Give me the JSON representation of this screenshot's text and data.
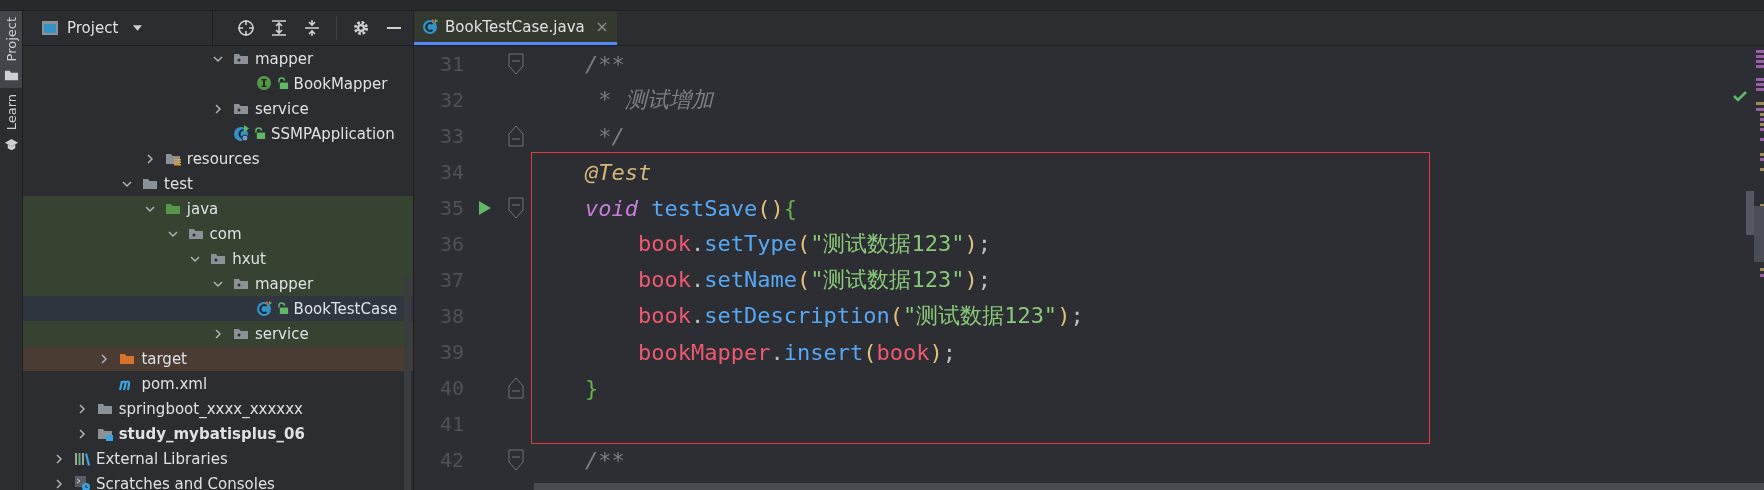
{
  "tool_stripe": [
    {
      "label": "Project",
      "kind": "project",
      "selected": true
    },
    {
      "label": "Learn",
      "kind": "learn",
      "selected": false
    }
  ],
  "project_panel": {
    "title": "Project",
    "tree": [
      {
        "label": "mapper",
        "kind": "package",
        "expanded": true,
        "selected": false,
        "children": [
          {
            "label": "BookMapper",
            "kind": "interface",
            "selected": false
          }
        ]
      },
      {
        "label": "service",
        "kind": "package",
        "expanded": false,
        "selected": false
      },
      {
        "label": "SSMPApplication",
        "kind": "app-class",
        "selected": false
      },
      {
        "label": "resources",
        "kind": "resources",
        "expanded": false,
        "selected": false
      },
      {
        "label": "test",
        "kind": "folder",
        "expanded": true,
        "selected": false,
        "children": [
          {
            "label": "java",
            "kind": "test-root",
            "expanded": true,
            "selected": false,
            "children": [
              {
                "label": "com",
                "kind": "package",
                "expanded": true,
                "selected": false,
                "children": [
                  {
                    "label": "hxut",
                    "kind": "package",
                    "expanded": true,
                    "selected": false,
                    "children": [
                      {
                        "label": "mapper",
                        "kind": "package",
                        "expanded": true,
                        "selected": false,
                        "children": [
                          {
                            "label": "BookTestCase",
                            "kind": "test-class",
                            "selected": true
                          }
                        ]
                      },
                      {
                        "label": "service",
                        "kind": "package",
                        "expanded": false,
                        "selected": false
                      }
                    ]
                  }
                ]
              }
            ]
          }
        ]
      },
      {
        "label": "target",
        "kind": "excluded",
        "expanded": false,
        "selected": false
      },
      {
        "label": "pom.xml",
        "kind": "maven",
        "selected": false
      },
      {
        "label": "springboot_xxxx_xxxxxx",
        "kind": "folder",
        "expanded": false,
        "selected": false
      },
      {
        "label": "study_mybatisplus_06",
        "kind": "module",
        "expanded": false,
        "selected": false
      },
      {
        "label": "External Libraries",
        "kind": "libraries",
        "expanded": false,
        "selected": false
      },
      {
        "label": "Scratches and Consoles",
        "kind": "scratches",
        "expanded": false,
        "selected": false
      }
    ]
  },
  "editor": {
    "tabs": [
      {
        "label": "BookTestCase.java",
        "selected": true
      }
    ],
    "lines": [
      {
        "number": "31",
        "run": false,
        "fold": {
          "kind": "start"
        },
        "tokens": [
          {
            "t": "    /**",
            "kind": "comment"
          }
        ]
      },
      {
        "number": "32",
        "run": false,
        "tokens": [
          {
            "t": "     * 测试增加",
            "kind": "comment"
          }
        ]
      },
      {
        "number": "33",
        "run": false,
        "fold": {
          "kind": "end"
        },
        "tokens": [
          {
            "t": "     */",
            "kind": "comment"
          }
        ]
      },
      {
        "number": "34",
        "run": false,
        "tokens": [
          {
            "t": "    @Test",
            "kind": "annotation"
          }
        ]
      },
      {
        "number": "35",
        "run": true,
        "fold": {
          "kind": "start"
        },
        "tokens": [
          {
            "t": "    void",
            "kind": "keyword"
          },
          {
            "t": " testSave",
            "kind": "method"
          },
          {
            "t": "()",
            "kind": "paren"
          },
          {
            "t": "{",
            "kind": "brace"
          }
        ]
      },
      {
        "number": "36",
        "run": false,
        "tokens": [
          {
            "t": "        book",
            "kind": "field"
          },
          {
            "t": ".",
            "kind": "punct"
          },
          {
            "t": "setType",
            "kind": "method"
          },
          {
            "t": "(",
            "kind": "paren"
          },
          {
            "t": "\"测试数据123\"",
            "kind": "string"
          },
          {
            "t": ")",
            "kind": "paren"
          },
          {
            "t": ";",
            "kind": "punct"
          }
        ]
      },
      {
        "number": "37",
        "run": false,
        "tokens": [
          {
            "t": "        book",
            "kind": "field"
          },
          {
            "t": ".",
            "kind": "punct"
          },
          {
            "t": "setName",
            "kind": "method"
          },
          {
            "t": "(",
            "kind": "paren"
          },
          {
            "t": "\"测试数据123\"",
            "kind": "string"
          },
          {
            "t": ")",
            "kind": "paren"
          },
          {
            "t": ";",
            "kind": "punct"
          }
        ]
      },
      {
        "number": "38",
        "run": false,
        "tokens": [
          {
            "t": "        book",
            "kind": "field"
          },
          {
            "t": ".",
            "kind": "punct"
          },
          {
            "t": "setDescription",
            "kind": "method"
          },
          {
            "t": "(",
            "kind": "paren"
          },
          {
            "t": "\"测试数据123\"",
            "kind": "string"
          },
          {
            "t": ")",
            "kind": "paren"
          },
          {
            "t": ";",
            "kind": "punct"
          }
        ]
      },
      {
        "number": "39",
        "run": false,
        "tokens": [
          {
            "t": "        bookMapper",
            "kind": "field"
          },
          {
            "t": ".",
            "kind": "punct"
          },
          {
            "t": "insert",
            "kind": "method"
          },
          {
            "t": "(",
            "kind": "paren"
          },
          {
            "t": "book",
            "kind": "field"
          },
          {
            "t": ")",
            "kind": "paren"
          },
          {
            "t": ";",
            "kind": "punct"
          }
        ]
      },
      {
        "number": "40",
        "run": false,
        "fold": {
          "kind": "end"
        },
        "tokens": [
          {
            "t": "    }",
            "kind": "brace"
          }
        ]
      },
      {
        "number": "41",
        "run": false
      },
      {
        "number": "42",
        "run": false,
        "fold": {
          "kind": "start"
        },
        "tokens": [
          {
            "t": "    /**",
            "kind": "comment"
          }
        ]
      }
    ]
  }
}
